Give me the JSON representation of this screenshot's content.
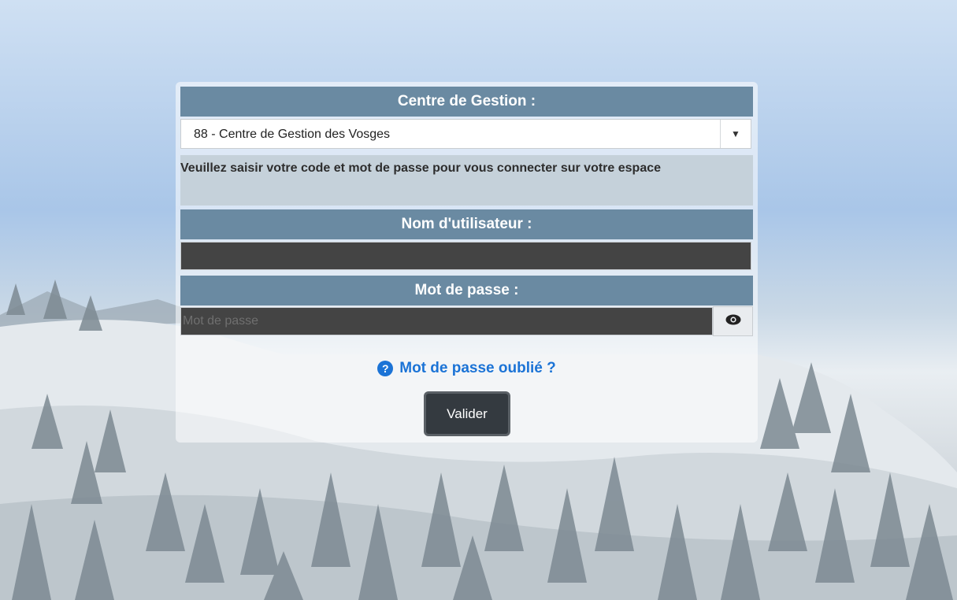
{
  "centre": {
    "header": "Centre de Gestion :",
    "selected": "88 - Centre de Gestion des Vosges"
  },
  "info_text": "Veuillez saisir votre code et mot de passe pour vous connecter sur votre espace",
  "username": {
    "header": "Nom d'utilisateur :",
    "value": "",
    "placeholder": ""
  },
  "password": {
    "header": "Mot de passe :",
    "value": "",
    "placeholder": "Mot de passe"
  },
  "forgot_link": "Mot de passe oublié ?",
  "submit_label": "Valider",
  "icons": {
    "select": "chevron-down-icon",
    "show_password": "eye-icon",
    "help": "question-circle-icon"
  },
  "colors": {
    "header_bg": "#6a8aa2",
    "link": "#1b73d6",
    "button_bg": "#343a40"
  }
}
